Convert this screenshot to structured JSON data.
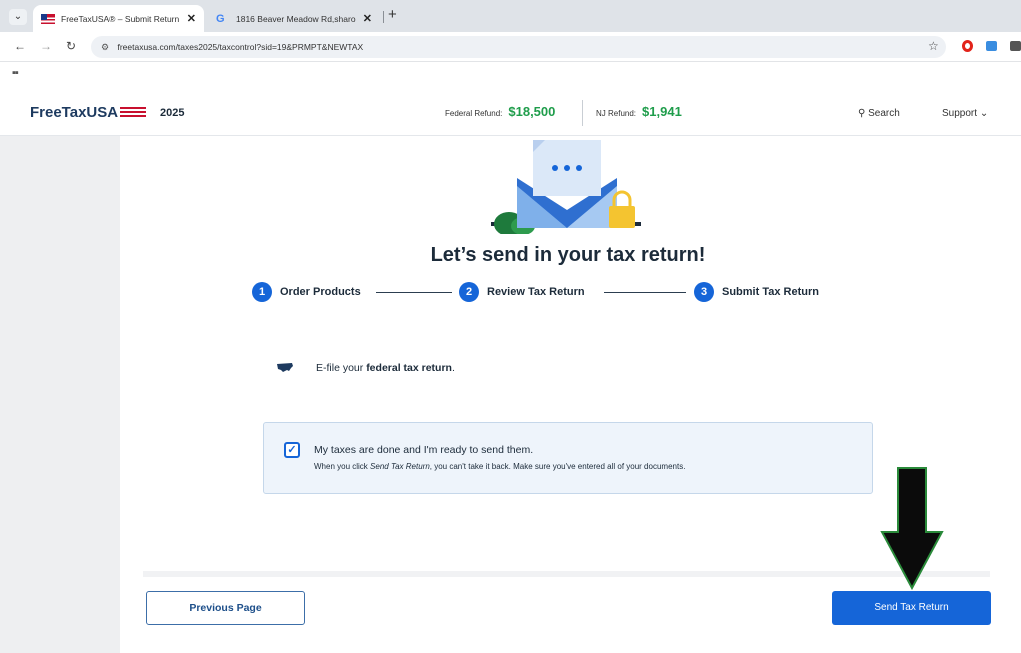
{
  "browser": {
    "tabs": [
      {
        "title": "FreeTaxUSA® – Submit Return",
        "active": true
      },
      {
        "title": "1816 Beaver Meadow Rd,sharo",
        "active": false
      }
    ],
    "url": "freetaxusa.com/taxes2025/taxcontrol?sid=19&PRMPT&NEWTAX"
  },
  "header": {
    "logo": "FreeTaxUSA",
    "tax_year": "2025",
    "federal_refund_label": "Federal Refund:",
    "federal_refund_amount": "$18,500",
    "nj_refund_label": "NJ Refund:",
    "nj_refund_amount": "$1,941",
    "search_label": "Search",
    "support_label": "Support"
  },
  "main": {
    "headline": "Let’s send in your tax return!",
    "steps": [
      {
        "number": "1",
        "label": "Order Products"
      },
      {
        "number": "2",
        "label": "Review Tax Return"
      },
      {
        "number": "3",
        "label": "Submit Tax Return"
      }
    ],
    "efile_prefix": "E-file your ",
    "efile_bold": "federal tax return",
    "efile_suffix": ".",
    "confirm_main": "My taxes are done and I'm ready to send them.",
    "confirm_sub_prefix": "When you click ",
    "confirm_sub_em": "Send Tax Return",
    "confirm_sub_suffix": ", you can't take it back. Make sure you've entered all of your documents.",
    "checkbox_checked": true
  },
  "footer": {
    "previous_label": "Previous Page",
    "send_label": "Send Tax Return"
  },
  "colors": {
    "accent": "#1565d8",
    "refund_green": "#1f9d4b",
    "heading": "#1c2b3a"
  }
}
